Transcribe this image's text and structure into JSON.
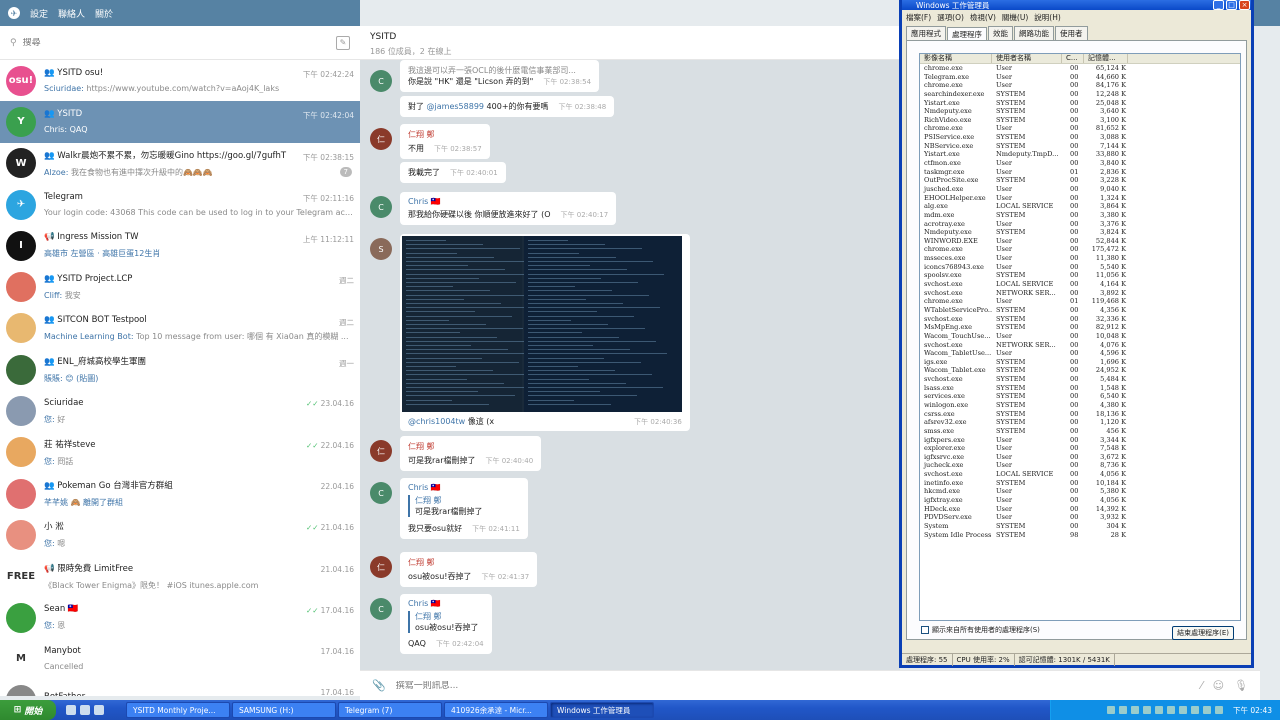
{
  "telegram": {
    "topbar": {
      "settings": "設定",
      "contacts": "聯絡人",
      "about": "關於"
    },
    "search_placeholder": "搜尋",
    "chats": [
      {
        "name": "YSITD osu!",
        "preview_prefix": "Sciuridae:",
        "preview": " https://www.youtube.com/watch?v=aAoj4K_laks",
        "time": "下午 02:42:24",
        "avatar_text": "osu!",
        "avatar_color": "#e8508f",
        "group": true
      },
      {
        "name": "YSITD",
        "preview_prefix": "Chris:",
        "preview": " QAQ",
        "time": "下午 02:42:04",
        "avatar_text": "Y",
        "avatar_color": "#3aa04e",
        "group": true,
        "active": true
      },
      {
        "name": "Walkr晨炮不累不累，勿忘暖暖Gino  https://goo.gl/7gufhT",
        "preview_prefix": "Alzoe:",
        "preview": " 我在食物也有進中擇次升級中的🙈🙈🙈",
        "time": "下午 02:38:15",
        "avatar_text": "W",
        "avatar_color": "#222",
        "group": true,
        "badge": "7"
      },
      {
        "name": "Telegram",
        "preview_prefix": "",
        "preview": "Your login code: 43068  This code can be used to log in to your Telegram acc...",
        "time": "下午 02:11:16",
        "avatar_text": "✈",
        "avatar_color": "#2ca5e0"
      },
      {
        "name": "Ingress Mission TW",
        "preview_prefix": "高雄市 左營區 · 高雄巨蛋12生肖",
        "preview": "",
        "time": "上午 11:12:11",
        "avatar_text": "I",
        "avatar_color": "#111",
        "channel": true
      },
      {
        "name": "YSITD Project.LCP",
        "preview_prefix": "Cliff:",
        "preview": " 我安",
        "time": "週二",
        "avatar_text": "",
        "avatar_color": "#e07060",
        "group": true
      },
      {
        "name": "SITCON BOT Testpool",
        "preview_prefix": "Machine Learning Bot:",
        "preview": " Top 10 message from user: 哪個 有 Xia0an 真的模糊 ...",
        "time": "週二",
        "avatar_text": "",
        "avatar_color": "#e8b870",
        "group": true
      },
      {
        "name": "ENL_府城高校學生軍團",
        "preview_prefix": "賬賬: 😊 (貼圖)",
        "preview": "",
        "time": "週一",
        "avatar_text": "",
        "avatar_color": "#3a6a3a",
        "group": true
      },
      {
        "name": "Sciuridae",
        "preview_prefix": "您:",
        "preview": " 好",
        "time": "23.04.16",
        "avatar_text": "",
        "avatar_color": "#8a9ab0",
        "check": true
      },
      {
        "name": "莊 祐祥steve",
        "preview_prefix": "您:",
        "preview": " 冏話",
        "time": "22.04.16",
        "avatar_text": "",
        "avatar_color": "#e8a860",
        "check": true
      },
      {
        "name": "Pokeman Go 台灣非官方群組",
        "preview_prefix": "芊芊姚 🙈 離開了群組",
        "preview": "",
        "time": "22.04.16",
        "avatar_text": "",
        "avatar_color": "#e07070",
        "group": true
      },
      {
        "name": "小 淞",
        "preview_prefix": "您:",
        "preview": " 嗯",
        "time": "21.04.16",
        "avatar_text": "",
        "avatar_color": "#e89080",
        "check": true
      },
      {
        "name": "限時免費 LimitFree",
        "preview_prefix": "",
        "preview": "《Black Tower Enigma》限免！ #iOS itunes.apple.com",
        "time": "21.04.16",
        "avatar_text": "FREE",
        "avatar_color": "#fff",
        "channel": true
      },
      {
        "name": "Sean 🇹🇼",
        "preview_prefix": "您:",
        "preview": " 恩",
        "time": "17.04.16",
        "avatar_text": "",
        "avatar_color": "#3aa040",
        "check": true
      },
      {
        "name": "Manybot",
        "preview_prefix": "",
        "preview": "Cancelled",
        "time": "17.04.16",
        "avatar_text": "M",
        "avatar_color": "#fff"
      },
      {
        "name": "BotFather",
        "preview_prefix": "",
        "preview": "",
        "time": "17.04.16",
        "avatar_text": "",
        "avatar_color": "#888"
      }
    ],
    "header": {
      "title": "YSITD",
      "subtitle": "186 位成員，2 在線上"
    },
    "messages": [
      {
        "lines": [
          "我這邊可以弄一張OCL的後什麼電信事業部司...",
          "你是說 \"HK\" 還是 \"Licson 弄的到\""
        ],
        "time": "下午 02:38:54"
      },
      {
        "text_prefix": "對了 ",
        "mention": "@james58899",
        "text": " 400+的你有要嗎",
        "time": "下午 02:38:48"
      },
      {
        "sender": "仁翔 鄭",
        "text": "不用",
        "time": "下午 02:38:57"
      },
      {
        "text": "我載完了",
        "time": "下午 02:40:01"
      },
      {
        "sender": "Chris 🇹🇼",
        "text": "那我給你硬碟以後 你順便放進來好了 (O",
        "time": "下午 02:40:17"
      },
      {
        "mention": "@chris1004tw",
        "text": " 像這 (x",
        "time": "下午 02:40:36"
      },
      {
        "sender": "仁翔 鄭",
        "text": "可是我rar檔刪掉了",
        "time": "下午 02:40:40"
      },
      {
        "sender": "Chris 🇹🇼",
        "quote_name": "仁翔 鄭",
        "quote_text": "可是我rar檔刪掉了",
        "text": "我只要osu就好",
        "time": "下午 02:41:11"
      },
      {
        "sender": "仁翔 鄭",
        "text": "osu被osu!吞掉了",
        "time": "下午 02:41:37"
      },
      {
        "sender": "Chris 🇹🇼",
        "quote_name": "仁翔 鄭",
        "quote_text": "osu被osu!吞掉了",
        "text": "QAQ",
        "time": "下午 02:42:04"
      }
    ],
    "compose_placeholder": "撰寫一則訊息..."
  },
  "taskmanager": {
    "title": "Windows 工作管理員",
    "menu": [
      "檔案(F)",
      "選項(O)",
      "檢視(V)",
      "關機(U)",
      "說明(H)"
    ],
    "tabs": [
      "應用程式",
      "處理程序",
      "效能",
      "網路功能",
      "使用者"
    ],
    "columns": [
      "影像名稱",
      "使用者名稱",
      "C...",
      "記憶體..."
    ],
    "processes": [
      [
        "chrome.exe",
        "User",
        "00",
        "65,124 K"
      ],
      [
        "Telegram.exe",
        "User",
        "00",
        "44,660 K"
      ],
      [
        "chrome.exe",
        "User",
        "00",
        "84,176 K"
      ],
      [
        "searchindexer.exe",
        "SYSTEM",
        "00",
        "12,248 K"
      ],
      [
        "Yistart.exe",
        "SYSTEM",
        "00",
        "25,048 K"
      ],
      [
        "Nmdeputy.exe",
        "SYSTEM",
        "00",
        "3,640 K"
      ],
      [
        "RichVideo.exe",
        "SYSTEM",
        "00",
        "3,100 K"
      ],
      [
        "chrome.exe",
        "User",
        "00",
        "81,652 K"
      ],
      [
        "PSIService.exe",
        "SYSTEM",
        "00",
        "3,088 K"
      ],
      [
        "NBService.exe",
        "SYSTEM",
        "00",
        "7,144 K"
      ],
      [
        "Yistart.exe",
        "Nmdeputy.TmpD...",
        "00",
        "33,880 K"
      ],
      [
        "ctfmon.exe",
        "User",
        "00",
        "3,840 K"
      ],
      [
        "taskmgr.exe",
        "User",
        "01",
        "2,836 K"
      ],
      [
        "OutProcSite.exe",
        "SYSTEM",
        "00",
        "3,228 K"
      ],
      [
        "jusched.exe",
        "User",
        "00",
        "9,040 K"
      ],
      [
        "EHOOLHelper.exe",
        "User",
        "00",
        "1,324 K"
      ],
      [
        "alg.exe",
        "LOCAL SERVICE",
        "00",
        "3,864 K"
      ],
      [
        "mdm.exe",
        "SYSTEM",
        "00",
        "3,380 K"
      ],
      [
        "acrotray.exe",
        "User",
        "00",
        "3,376 K"
      ],
      [
        "Nmdeputy.exe",
        "SYSTEM",
        "00",
        "3,824 K"
      ],
      [
        "WINWORD.EXE",
        "User",
        "00",
        "52,844 K"
      ],
      [
        "chrome.exe",
        "User",
        "00",
        "175,472 K"
      ],
      [
        "msseces.exe",
        "User",
        "00",
        "11,380 K"
      ],
      [
        "iconcs768943.exe",
        "User",
        "00",
        "5,540 K"
      ],
      [
        "spoolsv.exe",
        "SYSTEM",
        "00",
        "11,056 K"
      ],
      [
        "svchost.exe",
        "LOCAL SERVICE",
        "00",
        "4,164 K"
      ],
      [
        "svchost.exe",
        "NETWORK SER...",
        "00",
        "3,892 K"
      ],
      [
        "chrome.exe",
        "User",
        "01",
        "119,468 K"
      ],
      [
        "WTabletServicePro...",
        "SYSTEM",
        "00",
        "4,356 K"
      ],
      [
        "svchost.exe",
        "SYSTEM",
        "00",
        "32,336 K"
      ],
      [
        "MsMpEng.exe",
        "SYSTEM",
        "00",
        "82,912 K"
      ],
      [
        "Wacom_TouchUse...",
        "User",
        "00",
        "10,048 K"
      ],
      [
        "svchost.exe",
        "NETWORK SER...",
        "00",
        "4,076 K"
      ],
      [
        "Wacom_TabletUse...",
        "User",
        "00",
        "4,596 K"
      ],
      [
        "igs.exe",
        "SYSTEM",
        "00",
        "1,696 K"
      ],
      [
        "Wacom_Tablet.exe",
        "SYSTEM",
        "00",
        "24,952 K"
      ],
      [
        "svchost.exe",
        "SYSTEM",
        "00",
        "5,484 K"
      ],
      [
        "lsass.exe",
        "SYSTEM",
        "00",
        "1,548 K"
      ],
      [
        "services.exe",
        "SYSTEM",
        "00",
        "6,540 K"
      ],
      [
        "winlogon.exe",
        "SYSTEM",
        "00",
        "4,380 K"
      ],
      [
        "csrss.exe",
        "SYSTEM",
        "00",
        "18,136 K"
      ],
      [
        "afsrev32.exe",
        "SYSTEM",
        "00",
        "1,120 K"
      ],
      [
        "smss.exe",
        "SYSTEM",
        "00",
        "456 K"
      ],
      [
        "igfxpers.exe",
        "User",
        "00",
        "3,344 K"
      ],
      [
        "explorer.exe",
        "User",
        "00",
        "7,548 K"
      ],
      [
        "igfxsrvc.exe",
        "User",
        "00",
        "3,672 K"
      ],
      [
        "jucheck.exe",
        "User",
        "00",
        "8,736 K"
      ],
      [
        "svchost.exe",
        "LOCAL SERVICE",
        "00",
        "4,056 K"
      ],
      [
        "inetinfo.exe",
        "SYSTEM",
        "00",
        "10,184 K"
      ],
      [
        "hkcmd.exe",
        "User",
        "00",
        "5,380 K"
      ],
      [
        "igfxtray.exe",
        "User",
        "00",
        "4,056 K"
      ],
      [
        "HDeck.exe",
        "User",
        "00",
        "14,392 K"
      ],
      [
        "PDVDServ.exe",
        "User",
        "00",
        "3,932 K"
      ],
      [
        "System",
        "SYSTEM",
        "00",
        "304 K"
      ],
      [
        "System Idle Process",
        "SYSTEM",
        "98",
        "28 K"
      ]
    ],
    "show_all": "顯示來自所有使用者的處理程序(S)",
    "end_process": "結束處理程序(E)",
    "status": {
      "processes": "處理程序: 55",
      "cpu": "CPU 使用率: 2%",
      "commit": "認可記憶體: 1301K / 5431K"
    }
  },
  "taskbar": {
    "start": "開始",
    "tasks": [
      "YSITD Monthly Proje...",
      "SAMSUNG (H:)",
      "Telegram (7)",
      "410926余承達 - Micr...",
      "Windows 工作管理員"
    ],
    "clock": "下午 02:43"
  }
}
